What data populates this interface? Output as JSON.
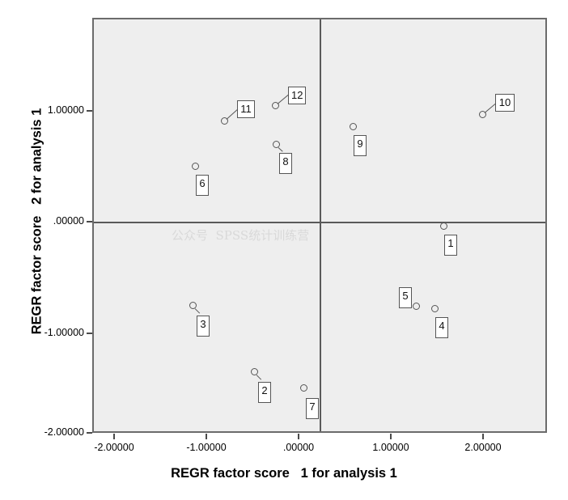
{
  "chart_data": {
    "type": "scatter",
    "title": "",
    "xlabel": "REGR factor score   1 for analysis 1",
    "ylabel": "REGR factor score   2 for analysis 1",
    "xlim": [
      -2.3,
      2.4
    ],
    "ylim": [
      -2.0,
      1.58
    ],
    "grid": false,
    "legend": null,
    "reference_lines": {
      "x": 0,
      "y": 0
    },
    "xticks": [
      -2,
      -1,
      0,
      1,
      2
    ],
    "xticklabels": [
      "-2.00000",
      "-1.00000",
      ".00000",
      "1.00000",
      "2.00000"
    ],
    "yticks": [
      1,
      0,
      -1,
      -2
    ],
    "yticklabels": [
      "1.00000",
      ".00000",
      "-1.00000",
      "-2.00000"
    ],
    "point_labels": [
      "1",
      "2",
      "3",
      "4",
      "5",
      "6",
      "7",
      "8",
      "9",
      "10",
      "11",
      "12"
    ],
    "points": [
      {
        "label": "1",
        "x": 1.56,
        "y": -0.02
      },
      {
        "label": "2",
        "x": -0.49,
        "y": -1.33
      },
      {
        "label": "3",
        "x": -1.16,
        "y": -0.73
      },
      {
        "label": "4",
        "x": 1.46,
        "y": -0.76
      },
      {
        "label": "5",
        "x": 1.26,
        "y": -0.74
      },
      {
        "label": "6",
        "x": -1.13,
        "y": 0.52
      },
      {
        "label": "7",
        "x": -0.04,
        "y": -1.47
      },
      {
        "label": "8",
        "x": -0.25,
        "y": 0.71
      },
      {
        "label": "9",
        "x": 0.58,
        "y": 0.87
      },
      {
        "label": "10",
        "x": 1.98,
        "y": 0.98
      },
      {
        "label": "11",
        "x": -0.82,
        "y": 0.92
      },
      {
        "label": "12",
        "x": -0.26,
        "y": 1.06
      }
    ]
  },
  "axes": {
    "x_title": "REGR factor score   1 for analysis 1",
    "y_title": "REGR factor score   2 for analysis 1",
    "x_ticklabels": [
      "-2.00000",
      "-1.00000",
      ".00000",
      "1.00000",
      "2.00000"
    ],
    "y_ticklabels": [
      "1.00000",
      ".00000",
      "-1.00000",
      "-2.00000"
    ]
  },
  "labels": {
    "p1": "1",
    "p2": "2",
    "p3": "3",
    "p4": "4",
    "p5": "5",
    "p6": "6",
    "p7": "7",
    "p8": "8",
    "p9": "9",
    "p10": "10",
    "p11": "11",
    "p12": "12"
  },
  "watermark": {
    "text": "公众号  SPSS统计训练营"
  },
  "colors": {
    "panel_background": "#eeeeee",
    "panel_border": "#6b6b6b",
    "reference_line": "#5a5a5a",
    "marker_stroke": "#555555",
    "label_background": "#ffffff",
    "text": "#000000",
    "watermark": "#d9d9d9"
  }
}
